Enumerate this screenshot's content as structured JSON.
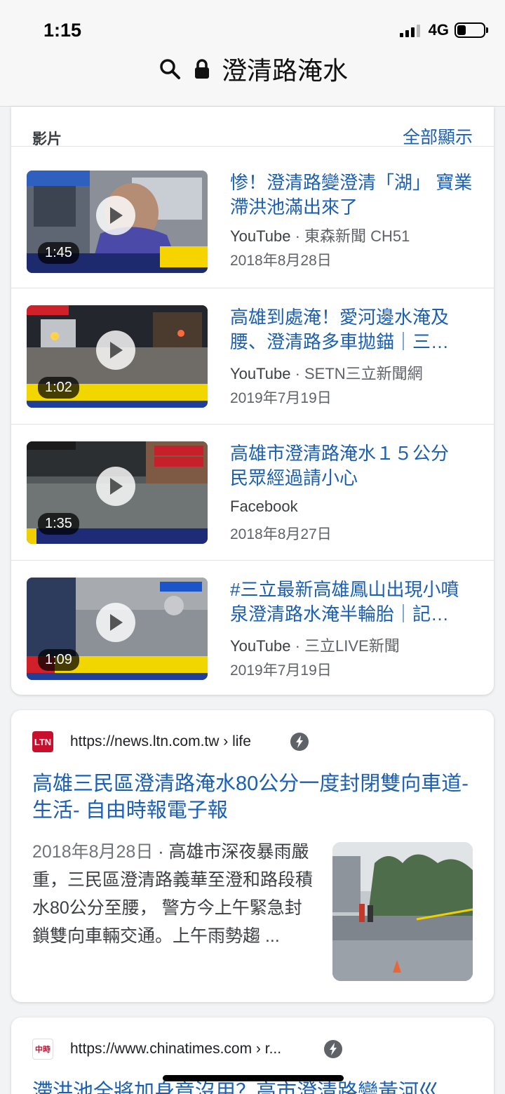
{
  "status": {
    "time": "1:15",
    "network": "4G"
  },
  "urlbar": {
    "query": "澄清路淹水"
  },
  "videos": {
    "heading": "影片",
    "show_all": "全部顯示",
    "items": [
      {
        "title": "惨！澄清路變澄清「湖」 寶業滯洪池滿出來了",
        "platform": "YouTube",
        "channel": " · 東森新聞 CH51",
        "date": "2018年8月28日",
        "duration": "1:45"
      },
      {
        "title": "高雄到處淹！愛河邊水淹及腰、澄清路多車拋錨｜三…",
        "platform": "YouTube",
        "channel": " · SETN三立新聞網",
        "date": "2019年7月19日",
        "duration": "1:02"
      },
      {
        "title": "高雄市澄清路淹水１５公分　民眾經過請小心",
        "platform": "Facebook",
        "channel": "",
        "date": "2018年8月27日",
        "duration": "1:35"
      },
      {
        "title": "#三立最新高雄鳳山出現小噴泉澄清路水淹半輪胎｜記…",
        "platform": "YouTube",
        "channel": " · 三立LIVE新聞",
        "date": "2019年7月19日",
        "duration": "1:09"
      }
    ]
  },
  "result1": {
    "favicon": "LTN",
    "url": "https://news.ltn.com.tw › life",
    "title": "高雄三民區澄清路淹水80公分一度封閉雙向車道- 生活- 自由時報電子報",
    "date": "2018年8月28日",
    "snippet": " · 高雄市深夜暴雨嚴重，三民區澄清路義華至澄和路段積水80公分至腰， 警方今上午緊急封鎖雙向車輛交通。上午雨勢趨 ..."
  },
  "result2": {
    "favicon": "中時",
    "url": "https://www.chinatimes.com › r...",
    "title": "滯洪池全將加身竟沒用？高市澄清路變黃河巛"
  },
  "colors": {
    "link": "#1a5fb4",
    "text": "#202124",
    "ltn": "#c8102e"
  }
}
